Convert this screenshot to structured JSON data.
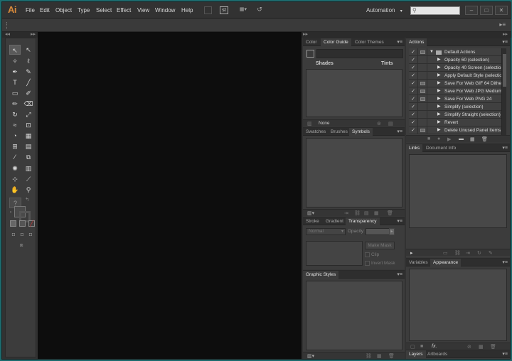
{
  "app": {
    "logo": "Ai"
  },
  "menu": [
    "File",
    "Edit",
    "Object",
    "Type",
    "Select",
    "Effect",
    "View",
    "Window",
    "Help"
  ],
  "menubar_icons": {
    "doc_setup": "st",
    "arrange": "▦▾",
    "gpu": "↺"
  },
  "workspace": {
    "label": "Automation",
    "arrow": "▾"
  },
  "window_buttons": {
    "minimize": "–",
    "maximize": "□",
    "close": "✕"
  },
  "panels": {
    "color_group": {
      "tabs": [
        "Color",
        "Color Guide",
        "Color Themes"
      ],
      "active": "Color Guide",
      "shades_label": "Shades",
      "tints_label": "Tints",
      "harmony_value": "None"
    },
    "swatches_group": {
      "tabs": [
        "Swatches",
        "Brushes",
        "Symbols"
      ],
      "active": "Symbols"
    },
    "stroke_group": {
      "tabs": [
        "Stroke",
        "Gradient",
        "Transparency"
      ],
      "active": "Transparency",
      "blend_mode": "Normal",
      "opacity_label": "Opacity:",
      "make_mask_label": "Make Mask",
      "clip_label": "Clip",
      "invert_mask_label": "Invert Mask"
    },
    "graphic_styles": {
      "tabs": [
        "Graphic Styles"
      ],
      "active": "Graphic Styles"
    },
    "actions": {
      "tabs": [
        "Actions"
      ],
      "active": "Actions",
      "set_name": "Default Actions",
      "items": [
        "Opacity 60 (selection)",
        "Opacity 40 Screen (selection)",
        "Apply Default Style (selection)",
        "Save For Web GIF 64 Dithe...",
        "Save For Web JPG Medium",
        "Save For Web PNG 24",
        "Simplify (selection)",
        "Simplify Straight (selection)",
        "Revert",
        "Delete Unused Panel Items"
      ]
    },
    "links_group": {
      "tabs": [
        "Links",
        "Document Info"
      ],
      "active": "Links"
    },
    "appearance_group": {
      "tabs": [
        "Variables",
        "Appearance"
      ],
      "active": "Appearance"
    },
    "layers_group": {
      "tabs": [
        "Layers",
        "Artboards"
      ],
      "active": "Layers"
    }
  }
}
